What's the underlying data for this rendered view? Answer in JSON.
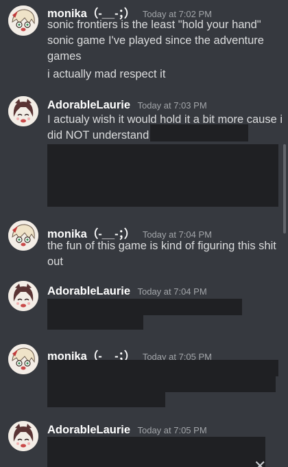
{
  "messages": [
    {
      "author": "monika（-__-；）",
      "time": "Today at 7:02 PM",
      "lines": [
        "sonic frontiers is the least \"hold your hand\"",
        "sonic game I've played since the adventure",
        "games",
        "i actually mad respect it"
      ]
    },
    {
      "author": "AdorableLaurie",
      "time": "Today at 7:03 PM",
      "lines": [
        "I actualy wish it would hold it a bit more cause i",
        "did NOT understand"
      ]
    },
    {
      "author": "monika（-__-；）",
      "time": "Today at 7:04 PM",
      "lines": [
        "the fun of this game is kind of figuring this shit",
        "out"
      ]
    },
    {
      "author": "AdorableLaurie",
      "time": "Today at 7:04 PM",
      "lines": []
    },
    {
      "author": "monika（-__-；）",
      "time": "Today at 7:05 PM",
      "lines": []
    },
    {
      "author": "AdorableLaurie",
      "time": "Today at 7:05 PM",
      "lines": []
    }
  ],
  "colors": {
    "background": "#36393f",
    "author": "#ffffff",
    "timestamp": "#a3a6aa",
    "message_text": "#dcddde",
    "redaction": "#1f2023"
  },
  "icons": {
    "monika_avatar": "avatar-monika-icon",
    "laurie_avatar": "avatar-laurie-icon",
    "close": "close-icon"
  }
}
